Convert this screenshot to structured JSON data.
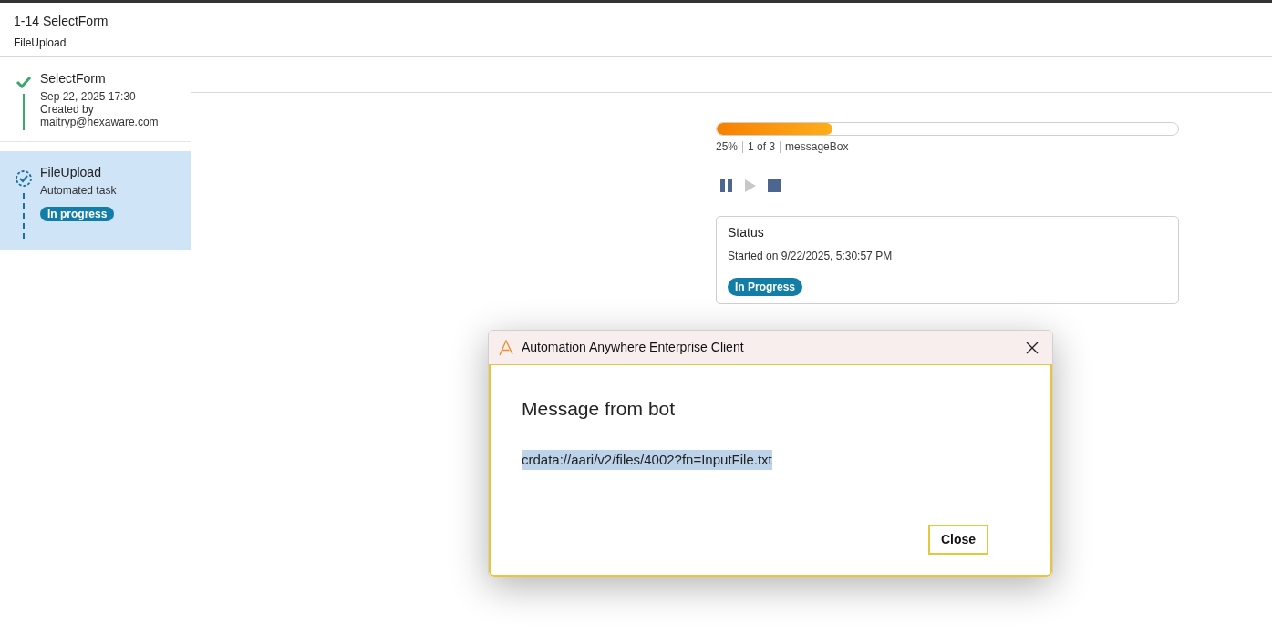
{
  "header": {
    "title": "1-14 SelectForm",
    "subtitle": "FileUpload"
  },
  "steps": [
    {
      "kind": "done",
      "selected": false,
      "name": "SelectForm",
      "lines": [
        "Sep 22, 2025 17:30",
        "Created by",
        "maitryp@hexaware.com"
      ]
    },
    {
      "kind": "running",
      "selected": true,
      "name": "FileUpload",
      "lines": [
        "Automated task"
      ],
      "badge": "In progress"
    }
  ],
  "progress": {
    "level": 0.25,
    "percent": "25%",
    "step": "1 of 3",
    "action": "messageBox"
  },
  "controls": [
    {
      "kind": "pause",
      "disabled": false
    },
    {
      "kind": "play",
      "disabled": true
    },
    {
      "kind": "stop",
      "disabled": false
    }
  ],
  "status": {
    "title": "Status",
    "started": "Started on 9/22/2025, 5:30:57 PM",
    "badge": "In Progress"
  },
  "dialog": {
    "title": "Automation Anywhere Enterprise Client",
    "heading": "Message from bot",
    "message": "crdata://aari/v2/files/4002?fn=InputFile.txt",
    "message_selected": true,
    "button": "Close"
  }
}
